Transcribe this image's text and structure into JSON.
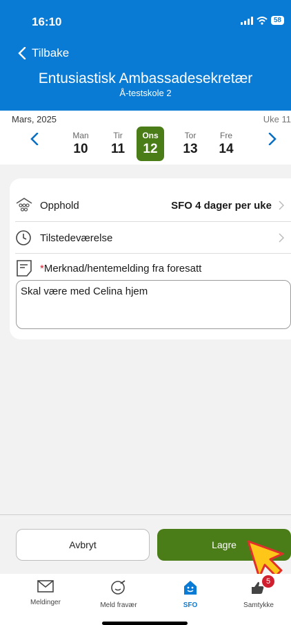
{
  "status_bar": {
    "time": "16:10",
    "battery": "58"
  },
  "header": {
    "back_label": "Tilbake",
    "title": "Entusiastisk Ambassadesekretær",
    "subtitle": "Å-testskole 2",
    "color": "#0a7bd5"
  },
  "week": {
    "month": "Mars, 2025",
    "week_label": "Uke 11",
    "days": [
      {
        "name": "Man",
        "date": "10"
      },
      {
        "name": "Tir",
        "date": "11"
      },
      {
        "name": "Ons",
        "date": "12"
      },
      {
        "name": "Tor",
        "date": "13"
      },
      {
        "name": "Fre",
        "date": "14"
      }
    ],
    "selected_index": 2,
    "accent": "#4a7c18"
  },
  "form": {
    "stay": {
      "label": "Opphold",
      "value": "SFO 4 dager per uke"
    },
    "attendance": {
      "label": "Tilstedeværelse"
    },
    "note": {
      "required_mark": "*",
      "label": "Merknad/hentemelding fra foresatt",
      "value": "Skal være med Celina hjem"
    }
  },
  "actions": {
    "cancel": "Avbryt",
    "save": "Lagre"
  },
  "tabs": [
    {
      "label": "Meldinger",
      "icon": "mail-icon"
    },
    {
      "label": "Meld fravær",
      "icon": "absence-icon"
    },
    {
      "label": "SFO",
      "icon": "sfo-house-icon"
    },
    {
      "label": "Samtykke",
      "icon": "thumbs-icon",
      "badge": "5"
    }
  ],
  "active_tab": "SFO"
}
